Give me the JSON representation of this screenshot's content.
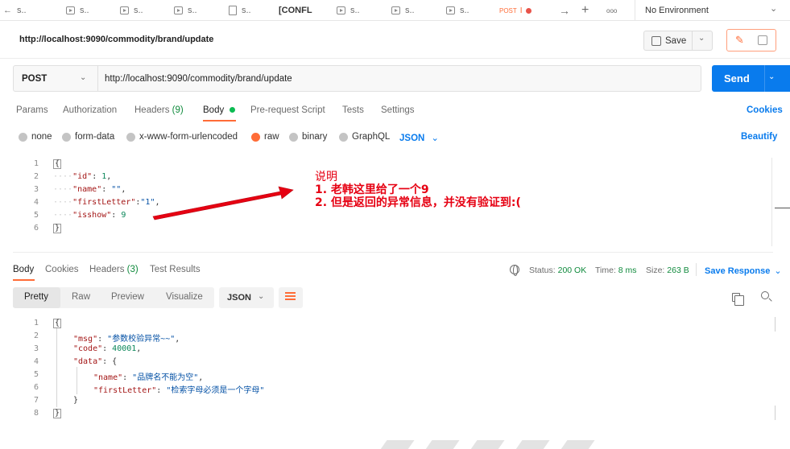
{
  "tabs": {
    "back_icon": "arrow-left-icon",
    "items": [
      {
        "type": "s..",
        "icon": "arrow-left-icon"
      },
      {
        "type": "s..",
        "icon": "request-icon"
      },
      {
        "type": "s..",
        "icon": "request-icon"
      },
      {
        "type": "s..",
        "icon": "request-icon"
      },
      {
        "type": "s..",
        "icon": "document-icon"
      },
      {
        "type": "[CONFL",
        "icon": ""
      },
      {
        "type": "s..",
        "icon": "request-icon"
      },
      {
        "type": "s..",
        "icon": "request-icon"
      },
      {
        "type": "s..",
        "icon": "request-icon"
      }
    ],
    "active": {
      "method": "POST",
      "separator": "I"
    },
    "arrow": "→",
    "plus": "+",
    "more": "ooo",
    "environment": "No Environment",
    "env_chevron": "⌄"
  },
  "title_row": {
    "url": "http://localhost:9090/commodity/brand/update",
    "save_label": "Save",
    "save_chevron": "⌄",
    "edit_icon": "✎"
  },
  "request": {
    "method": "POST",
    "method_chevron": "⌄",
    "url": "http://localhost:9090/commodity/brand/update",
    "send_label": "Send",
    "send_chevron": "⌄"
  },
  "request_tabs": {
    "params": "Params",
    "authorization": "Authorization",
    "headers": "Headers",
    "headers_count": "(9)",
    "body": "Body",
    "prerequest": "Pre-request Script",
    "tests": "Tests",
    "settings": "Settings",
    "cookies": "Cookies"
  },
  "body_types": {
    "none": "none",
    "form_data": "form-data",
    "urlencoded": "x-www-form-urlencoded",
    "raw": "raw",
    "binary": "binary",
    "graphql": "GraphQL",
    "format": "JSON",
    "format_chevron": "⌄",
    "beautify": "Beautify"
  },
  "request_body": {
    "line_numbers": [
      "1",
      "2",
      "3",
      "4",
      "5",
      "6"
    ],
    "open": "{",
    "close": "}",
    "lines": [
      {
        "key": "\"id\"",
        "sep": ": ",
        "val": "1",
        "tail": ","
      },
      {
        "key": "\"name\"",
        "sep": ": ",
        "val": "\"\"",
        "tail": ","
      },
      {
        "key": "\"firstLetter\"",
        "sep": ":",
        "val": "\"1\"",
        "tail": ","
      },
      {
        "key": "\"isshow\"",
        "sep": ": ",
        "val": "9",
        "tail": ""
      }
    ]
  },
  "annotation": {
    "title": "说明",
    "line1": "1. 老韩这里给了一个9",
    "line2": "2. 但是返回的异常信息，并没有验证到:(",
    "color": "#e60012"
  },
  "response_tabs": {
    "body": "Body",
    "cookies": "Cookies",
    "headers": "Headers",
    "headers_count": "(3)",
    "test_results": "Test Results"
  },
  "response_status": {
    "status_label": "Status:",
    "status_value": "200 OK",
    "time_label": "Time:",
    "time_value": "8 ms",
    "size_label": "Size:",
    "size_value": "263 B",
    "save_response": "Save Response",
    "save_chevron": "⌄"
  },
  "response_view": {
    "pretty": "Pretty",
    "raw": "Raw",
    "preview": "Preview",
    "visualize": "Visualize",
    "format": "JSON",
    "format_chevron": "⌄"
  },
  "response_body": {
    "line_numbers": [
      "1",
      "2",
      "3",
      "4",
      "5",
      "6",
      "7",
      "8"
    ],
    "open": "{",
    "close": "}",
    "msg_key": "\"msg\"",
    "msg_val": "\"参数校验异常~~\"",
    "code_key": "\"code\"",
    "code_val": "40001",
    "data_key": "\"data\"",
    "data_open": "{",
    "data_close": "}",
    "name_key": "\"name\"",
    "name_val": "\"品牌名不能为空\"",
    "fl_key": "\"firstLetter\"",
    "fl_val": "\"检索字母必须是一个字母\""
  },
  "colors": {
    "accent": "#ff6c37",
    "primary": "#097bed",
    "success": "#0f8a3c"
  }
}
